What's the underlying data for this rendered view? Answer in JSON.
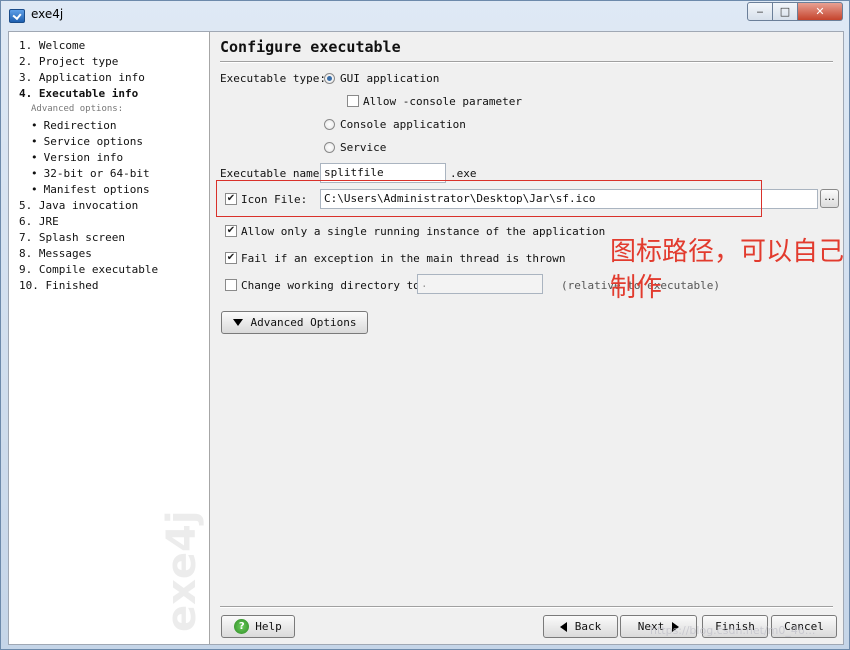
{
  "window": {
    "title": "exe4j",
    "min": "‒",
    "max": "□",
    "close": "✕"
  },
  "sidebar": {
    "steps_top": [
      {
        "label": "1. Welcome"
      },
      {
        "label": "2. Project type"
      },
      {
        "label": "3. Application info"
      },
      {
        "label": "4. Executable info"
      }
    ],
    "advanced_header": "Advanced options:",
    "substeps": [
      {
        "label": "Redirection"
      },
      {
        "label": "Service options"
      },
      {
        "label": "Version info"
      },
      {
        "label": "32-bit or 64-bit"
      },
      {
        "label": "Manifest options"
      }
    ],
    "steps_bottom": [
      {
        "label": "5. Java invocation"
      },
      {
        "label": "6. JRE"
      },
      {
        "label": "7. Splash screen"
      },
      {
        "label": "8. Messages"
      },
      {
        "label": "9. Compile executable"
      },
      {
        "label": "10. Finished"
      }
    ],
    "watermark": "exe4j"
  },
  "main": {
    "title": "Configure executable",
    "exe_type_label": "Executable type:",
    "gui_label": "GUI application",
    "allow_console_label": "Allow -console parameter",
    "console_label": "Console application",
    "service_label": "Service",
    "exe_name_label": "Executable name:",
    "exe_name_value": "splitfile",
    "exe_ext": ".exe",
    "icon_file_label": "Icon File:",
    "icon_file_value": "C:\\Users\\Administrator\\Desktop\\Jar\\sf.ico",
    "browse_label": "...",
    "single_instance_label": "Allow only a single running instance of the application",
    "fail_exception_label": "Fail if an exception in the main thread is thrown",
    "change_dir_label": "Change working directory to:",
    "change_dir_value": ".",
    "relative_note": "(relative to executable)",
    "advanced_button": "Advanced Options",
    "check_mark": "✔"
  },
  "footer": {
    "help": "Help",
    "back": "Back",
    "next": "Next",
    "finish": "Finish",
    "cancel": "Cancel"
  },
  "annotation": {
    "text": "图标路径，可以自己制作"
  },
  "url_watermark": "https://blog.csdn.net/m0_46..."
}
